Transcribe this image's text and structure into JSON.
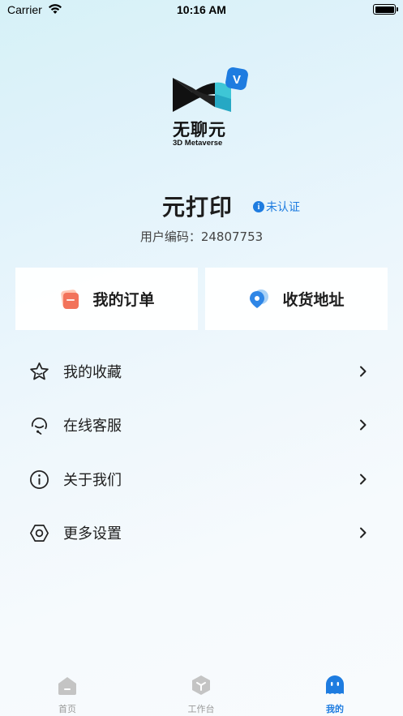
{
  "status_bar": {
    "carrier": "Carrier",
    "time": "10:16 AM"
  },
  "logo": {
    "brand_text": "无聊元",
    "sub_text": "3D Metaverse",
    "badge": "V"
  },
  "profile": {
    "username": "元打印",
    "verify_status": "未认证",
    "user_code": "用户编码：24807753"
  },
  "cards": {
    "orders": "我的订单",
    "address": "收货地址"
  },
  "menu": [
    {
      "label": "我的收藏",
      "icon": "star-icon"
    },
    {
      "label": "在线客服",
      "icon": "headset-icon"
    },
    {
      "label": "关于我们",
      "icon": "info-icon"
    },
    {
      "label": "更多设置",
      "icon": "settings-hex-icon"
    }
  ],
  "tabs": [
    {
      "label": "首页",
      "icon": "home-icon",
      "active": false
    },
    {
      "label": "工作台",
      "icon": "cube-icon",
      "active": false
    },
    {
      "label": "我的",
      "icon": "profile-ghost-icon",
      "active": true
    }
  ],
  "colors": {
    "accent": "#1e7ce0",
    "inactive": "#999999",
    "text": "#1d1d1d"
  }
}
